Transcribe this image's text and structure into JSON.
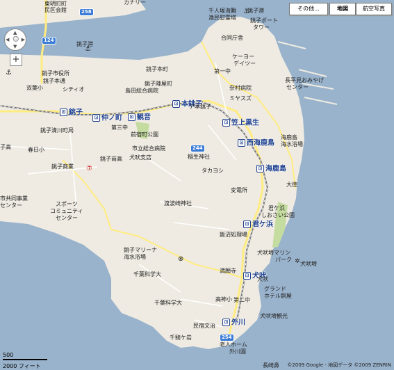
{
  "controls": {
    "more_label": "その他...",
    "map_label": "地図",
    "satellite_label": "航空写真",
    "zoom_in": "+",
    "scale_m": "500",
    "scale_ft": "2000 フィート",
    "copyright": "©2009 Google - 地図データ ©2009 ZENRIN"
  },
  "stations": [
    {
      "name": "銚子"
    },
    {
      "name": "仲ノ町"
    },
    {
      "name": "観音"
    },
    {
      "name": "本銚子"
    },
    {
      "name": "笠上黒生"
    },
    {
      "name": "西海鹿島"
    },
    {
      "name": "海鹿島"
    },
    {
      "name": "君ケ浜"
    },
    {
      "name": "犬吠"
    },
    {
      "name": "外川"
    }
  ],
  "places": [
    {
      "text": "カナリー"
    },
    {
      "text": "東明町町"
    },
    {
      "text": "民区会館"
    },
    {
      "text": "銚子港"
    },
    {
      "text": "千人塚海難"
    },
    {
      "text": "漁民慰霊塔"
    },
    {
      "text": "銚子港"
    },
    {
      "text": "銚子ポート"
    },
    {
      "text": "タワー"
    },
    {
      "text": "合同庁舎"
    },
    {
      "text": "銚子市役所"
    },
    {
      "text": "銚子本通"
    },
    {
      "text": "シティオ"
    },
    {
      "text": "銚子本町"
    },
    {
      "text": "双葉小"
    },
    {
      "text": "島田総合病院"
    },
    {
      "text": "銚子陣屋町"
    },
    {
      "text": "第一中"
    },
    {
      "text": "ケーヨー"
    },
    {
      "text": "デイツー"
    },
    {
      "text": "奈村病院"
    },
    {
      "text": "ミヤスズ"
    },
    {
      "text": "長平見おみやげ"
    },
    {
      "text": "センター"
    },
    {
      "text": "ア本銚子"
    },
    {
      "text": "銚子清川町局"
    },
    {
      "text": "第三中"
    },
    {
      "text": "前宿町公園"
    },
    {
      "text": "春日小"
    },
    {
      "text": "市立総合病院"
    },
    {
      "text": "銚子商高"
    },
    {
      "text": "犬吠支店"
    },
    {
      "text": "稲生神社"
    },
    {
      "text": "タカヨシ"
    },
    {
      "text": "海鹿島"
    },
    {
      "text": "海水浴場"
    },
    {
      "text": "大徳"
    },
    {
      "text": "銚子商業"
    },
    {
      "text": "変電所"
    },
    {
      "text": "スポーツ"
    },
    {
      "text": "コミュニティ"
    },
    {
      "text": "センター"
    },
    {
      "text": "渡波崎神社"
    },
    {
      "text": "君ケ浜"
    },
    {
      "text": "しおさい公園"
    },
    {
      "text": "飯沼処理場"
    },
    {
      "text": "銚子マリーナ"
    },
    {
      "text": "海水浴場"
    },
    {
      "text": "犬吠埼マリン"
    },
    {
      "text": "パーク"
    },
    {
      "text": "犬吠埼"
    },
    {
      "text": "千葉科学大"
    },
    {
      "text": "満願寺"
    },
    {
      "text": "犬吠"
    },
    {
      "text": "グランド"
    },
    {
      "text": "ホテル銅屋"
    },
    {
      "text": "千葉科学大"
    },
    {
      "text": "高神小"
    },
    {
      "text": "第二中"
    },
    {
      "text": "犬吠埼観光"
    },
    {
      "text": "民宿文治"
    },
    {
      "text": "千騎ケ岩"
    },
    {
      "text": "老人ホーム"
    },
    {
      "text": "外川園"
    },
    {
      "text": "長崎鼻"
    },
    {
      "text": "市共同事業"
    },
    {
      "text": "センター"
    },
    {
      "text": "子高"
    }
  ],
  "routes": [
    {
      "number": "124"
    },
    {
      "number": "258"
    },
    {
      "number": "244"
    },
    {
      "number": "254"
    }
  ],
  "colors": {
    "sea": "#99b3cc",
    "land": "#efebe2",
    "road": "#ffec80",
    "park": "#c5dca0",
    "station": "#1d3f8f"
  }
}
